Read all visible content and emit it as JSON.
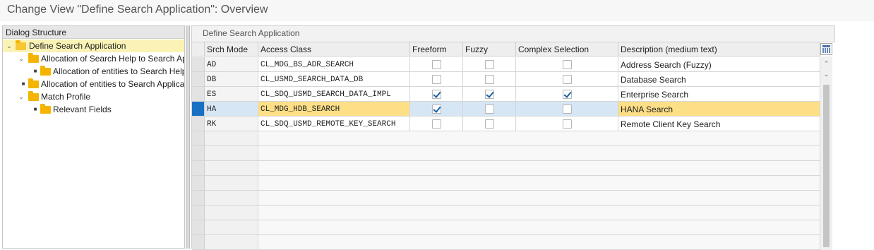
{
  "window": {
    "title": "Change View \"Define Search Application\": Overview"
  },
  "dialog_structure": {
    "header": "Dialog Structure",
    "nodes": [
      {
        "label": "Define Search Application"
      },
      {
        "label": "Allocation of Search Help to Search Application"
      },
      {
        "label": "Allocation of entities to Search Help"
      },
      {
        "label": "Allocation of entities to Search Application"
      },
      {
        "label": "Match Profile"
      },
      {
        "label": "Relevant Fields"
      }
    ]
  },
  "table": {
    "caption": "Define Search Application",
    "columns": [
      "Srch Mode",
      "Access Class",
      "Freeform",
      "Fuzzy",
      "Complex Selection",
      "Description (medium text)"
    ],
    "rows": [
      {
        "mode": "AD",
        "access_class": "CL_MDG_BS_ADR_SEARCH",
        "freeform": false,
        "fuzzy": false,
        "complex": false,
        "description": "Address Search (Fuzzy)",
        "selected": false
      },
      {
        "mode": "DB",
        "access_class": "CL_USMD_SEARCH_DATA_DB",
        "freeform": false,
        "fuzzy": false,
        "complex": false,
        "description": "Database Search",
        "selected": false
      },
      {
        "mode": "ES",
        "access_class": "CL_SDQ_USMD_SEARCH_DATA_IMPL",
        "freeform": true,
        "fuzzy": true,
        "complex": true,
        "description": "Enterprise Search",
        "selected": false
      },
      {
        "mode": "HA",
        "access_class": "CL_MDG_HDB_SEARCH",
        "freeform": true,
        "fuzzy": false,
        "complex": false,
        "description": "HANA Search",
        "selected": true
      },
      {
        "mode": "RK",
        "access_class": "CL_SDQ_USMD_REMOTE_KEY_SEARCH",
        "freeform": false,
        "fuzzy": false,
        "complex": false,
        "description": "Remote Client Key Search",
        "selected": false
      }
    ]
  },
  "icons": {
    "table_settings": "table-settings-icon",
    "scroll_up": "scroll-up-icon",
    "scroll_down": "scroll-down-icon"
  },
  "colors": {
    "selected_row": "#fddf86",
    "selected_marker": "#1a71c4",
    "tree_selected": "#fbf3b6",
    "folder": "#f4b400"
  }
}
